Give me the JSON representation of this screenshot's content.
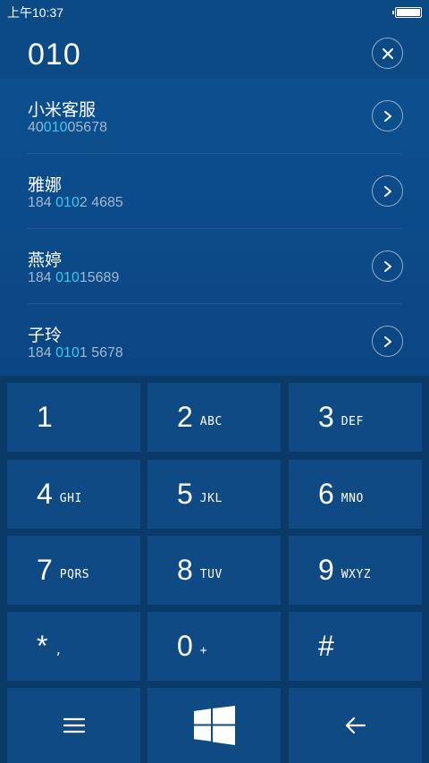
{
  "status_bar": {
    "time": "上午10:37"
  },
  "dialer": {
    "number": "010"
  },
  "contacts": [
    {
      "name": "小米客服",
      "number_parts": [
        "40",
        "010",
        "05678"
      ]
    },
    {
      "name": "雅娜",
      "number_parts": [
        "184 ",
        "010",
        "2 4685"
      ]
    },
    {
      "name": "燕婷",
      "number_parts": [
        "184 ",
        "010",
        "15689"
      ]
    },
    {
      "name": "子玲",
      "number_parts": [
        "184 ",
        "010",
        "1 5678"
      ]
    }
  ],
  "keypad": [
    {
      "digit": "1",
      "letters": ""
    },
    {
      "digit": "2",
      "letters": "ABC"
    },
    {
      "digit": "3",
      "letters": "DEF"
    },
    {
      "digit": "4",
      "letters": "GHI"
    },
    {
      "digit": "5",
      "letters": "JKL"
    },
    {
      "digit": "6",
      "letters": "MNO"
    },
    {
      "digit": "7",
      "letters": "PQRS"
    },
    {
      "digit": "8",
      "letters": "TUV"
    },
    {
      "digit": "9",
      "letters": "WXYZ"
    },
    {
      "digit": "*",
      "letters": ","
    },
    {
      "digit": "0",
      "letters": "+"
    },
    {
      "digit": "#",
      "letters": ""
    }
  ],
  "bottom_bar": {
    "menu_icon": "menu-icon",
    "windows_icon": "windows-logo-icon",
    "back_icon": "arrow-left-icon"
  },
  "colors": {
    "background": "#0a3d6e",
    "highlight": "#35c9f2",
    "key": "#0f4a84"
  }
}
